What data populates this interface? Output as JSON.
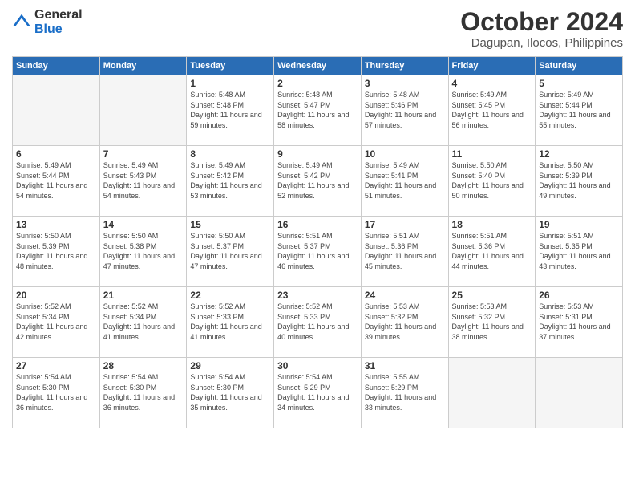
{
  "logo": {
    "general": "General",
    "blue": "Blue"
  },
  "title": "October 2024",
  "location": "Dagupan, Ilocos, Philippines",
  "headers": [
    "Sunday",
    "Monday",
    "Tuesday",
    "Wednesday",
    "Thursday",
    "Friday",
    "Saturday"
  ],
  "weeks": [
    [
      {
        "day": "",
        "sunrise": "",
        "sunset": "",
        "daylight": "",
        "empty": true
      },
      {
        "day": "",
        "sunrise": "",
        "sunset": "",
        "daylight": "",
        "empty": true
      },
      {
        "day": "1",
        "sunrise": "Sunrise: 5:48 AM",
        "sunset": "Sunset: 5:48 PM",
        "daylight": "Daylight: 11 hours and 59 minutes.",
        "empty": false
      },
      {
        "day": "2",
        "sunrise": "Sunrise: 5:48 AM",
        "sunset": "Sunset: 5:47 PM",
        "daylight": "Daylight: 11 hours and 58 minutes.",
        "empty": false
      },
      {
        "day": "3",
        "sunrise": "Sunrise: 5:48 AM",
        "sunset": "Sunset: 5:46 PM",
        "daylight": "Daylight: 11 hours and 57 minutes.",
        "empty": false
      },
      {
        "day": "4",
        "sunrise": "Sunrise: 5:49 AM",
        "sunset": "Sunset: 5:45 PM",
        "daylight": "Daylight: 11 hours and 56 minutes.",
        "empty": false
      },
      {
        "day": "5",
        "sunrise": "Sunrise: 5:49 AM",
        "sunset": "Sunset: 5:44 PM",
        "daylight": "Daylight: 11 hours and 55 minutes.",
        "empty": false
      }
    ],
    [
      {
        "day": "6",
        "sunrise": "Sunrise: 5:49 AM",
        "sunset": "Sunset: 5:44 PM",
        "daylight": "Daylight: 11 hours and 54 minutes.",
        "empty": false
      },
      {
        "day": "7",
        "sunrise": "Sunrise: 5:49 AM",
        "sunset": "Sunset: 5:43 PM",
        "daylight": "Daylight: 11 hours and 54 minutes.",
        "empty": false
      },
      {
        "day": "8",
        "sunrise": "Sunrise: 5:49 AM",
        "sunset": "Sunset: 5:42 PM",
        "daylight": "Daylight: 11 hours and 53 minutes.",
        "empty": false
      },
      {
        "day": "9",
        "sunrise": "Sunrise: 5:49 AM",
        "sunset": "Sunset: 5:42 PM",
        "daylight": "Daylight: 11 hours and 52 minutes.",
        "empty": false
      },
      {
        "day": "10",
        "sunrise": "Sunrise: 5:49 AM",
        "sunset": "Sunset: 5:41 PM",
        "daylight": "Daylight: 11 hours and 51 minutes.",
        "empty": false
      },
      {
        "day": "11",
        "sunrise": "Sunrise: 5:50 AM",
        "sunset": "Sunset: 5:40 PM",
        "daylight": "Daylight: 11 hours and 50 minutes.",
        "empty": false
      },
      {
        "day": "12",
        "sunrise": "Sunrise: 5:50 AM",
        "sunset": "Sunset: 5:39 PM",
        "daylight": "Daylight: 11 hours and 49 minutes.",
        "empty": false
      }
    ],
    [
      {
        "day": "13",
        "sunrise": "Sunrise: 5:50 AM",
        "sunset": "Sunset: 5:39 PM",
        "daylight": "Daylight: 11 hours and 48 minutes.",
        "empty": false
      },
      {
        "day": "14",
        "sunrise": "Sunrise: 5:50 AM",
        "sunset": "Sunset: 5:38 PM",
        "daylight": "Daylight: 11 hours and 47 minutes.",
        "empty": false
      },
      {
        "day": "15",
        "sunrise": "Sunrise: 5:50 AM",
        "sunset": "Sunset: 5:37 PM",
        "daylight": "Daylight: 11 hours and 47 minutes.",
        "empty": false
      },
      {
        "day": "16",
        "sunrise": "Sunrise: 5:51 AM",
        "sunset": "Sunset: 5:37 PM",
        "daylight": "Daylight: 11 hours and 46 minutes.",
        "empty": false
      },
      {
        "day": "17",
        "sunrise": "Sunrise: 5:51 AM",
        "sunset": "Sunset: 5:36 PM",
        "daylight": "Daylight: 11 hours and 45 minutes.",
        "empty": false
      },
      {
        "day": "18",
        "sunrise": "Sunrise: 5:51 AM",
        "sunset": "Sunset: 5:36 PM",
        "daylight": "Daylight: 11 hours and 44 minutes.",
        "empty": false
      },
      {
        "day": "19",
        "sunrise": "Sunrise: 5:51 AM",
        "sunset": "Sunset: 5:35 PM",
        "daylight": "Daylight: 11 hours and 43 minutes.",
        "empty": false
      }
    ],
    [
      {
        "day": "20",
        "sunrise": "Sunrise: 5:52 AM",
        "sunset": "Sunset: 5:34 PM",
        "daylight": "Daylight: 11 hours and 42 minutes.",
        "empty": false
      },
      {
        "day": "21",
        "sunrise": "Sunrise: 5:52 AM",
        "sunset": "Sunset: 5:34 PM",
        "daylight": "Daylight: 11 hours and 41 minutes.",
        "empty": false
      },
      {
        "day": "22",
        "sunrise": "Sunrise: 5:52 AM",
        "sunset": "Sunset: 5:33 PM",
        "daylight": "Daylight: 11 hours and 41 minutes.",
        "empty": false
      },
      {
        "day": "23",
        "sunrise": "Sunrise: 5:52 AM",
        "sunset": "Sunset: 5:33 PM",
        "daylight": "Daylight: 11 hours and 40 minutes.",
        "empty": false
      },
      {
        "day": "24",
        "sunrise": "Sunrise: 5:53 AM",
        "sunset": "Sunset: 5:32 PM",
        "daylight": "Daylight: 11 hours and 39 minutes.",
        "empty": false
      },
      {
        "day": "25",
        "sunrise": "Sunrise: 5:53 AM",
        "sunset": "Sunset: 5:32 PM",
        "daylight": "Daylight: 11 hours and 38 minutes.",
        "empty": false
      },
      {
        "day": "26",
        "sunrise": "Sunrise: 5:53 AM",
        "sunset": "Sunset: 5:31 PM",
        "daylight": "Daylight: 11 hours and 37 minutes.",
        "empty": false
      }
    ],
    [
      {
        "day": "27",
        "sunrise": "Sunrise: 5:54 AM",
        "sunset": "Sunset: 5:30 PM",
        "daylight": "Daylight: 11 hours and 36 minutes.",
        "empty": false
      },
      {
        "day": "28",
        "sunrise": "Sunrise: 5:54 AM",
        "sunset": "Sunset: 5:30 PM",
        "daylight": "Daylight: 11 hours and 36 minutes.",
        "empty": false
      },
      {
        "day": "29",
        "sunrise": "Sunrise: 5:54 AM",
        "sunset": "Sunset: 5:30 PM",
        "daylight": "Daylight: 11 hours and 35 minutes.",
        "empty": false
      },
      {
        "day": "30",
        "sunrise": "Sunrise: 5:54 AM",
        "sunset": "Sunset: 5:29 PM",
        "daylight": "Daylight: 11 hours and 34 minutes.",
        "empty": false
      },
      {
        "day": "31",
        "sunrise": "Sunrise: 5:55 AM",
        "sunset": "Sunset: 5:29 PM",
        "daylight": "Daylight: 11 hours and 33 minutes.",
        "empty": false
      },
      {
        "day": "",
        "sunrise": "",
        "sunset": "",
        "daylight": "",
        "empty": true
      },
      {
        "day": "",
        "sunrise": "",
        "sunset": "",
        "daylight": "",
        "empty": true
      }
    ]
  ]
}
